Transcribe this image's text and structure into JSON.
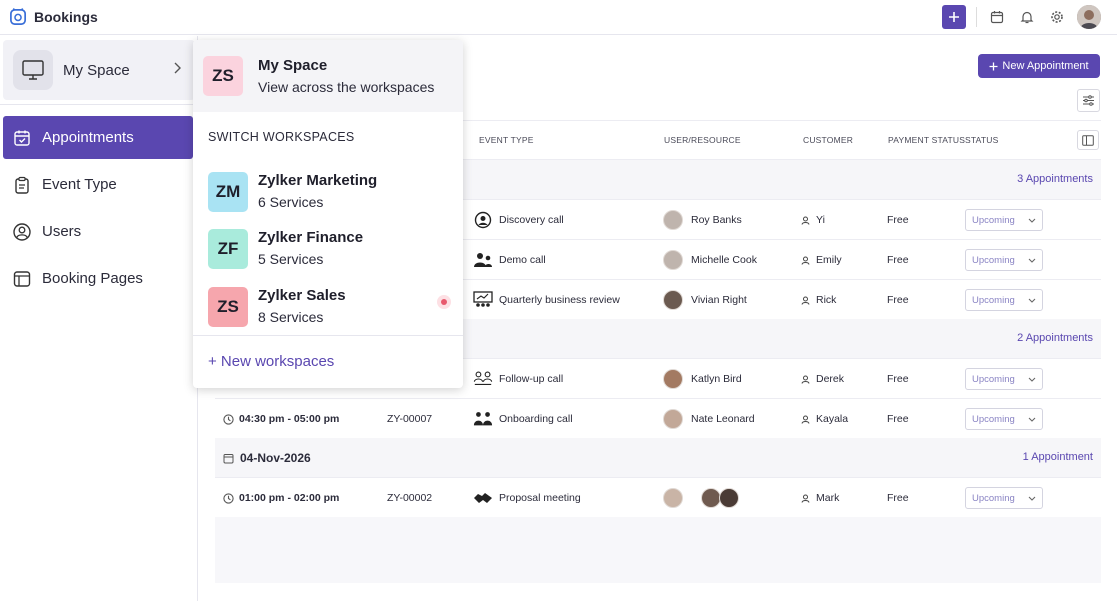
{
  "app": {
    "title": "Bookings"
  },
  "sidebar": {
    "space": {
      "label": "My Space"
    },
    "items": [
      {
        "label": "Appointments",
        "icon": "calendar-check-icon",
        "active": true
      },
      {
        "label": "Event Type",
        "icon": "clipboard-icon",
        "active": false
      },
      {
        "label": "Users",
        "icon": "user-circle-icon",
        "active": false
      },
      {
        "label": "Booking Pages",
        "icon": "browser-window-icon",
        "active": false
      }
    ]
  },
  "toolbar": {
    "new_appointment": "New Appointment"
  },
  "table": {
    "headers": [
      "EVENT TYPE",
      "USER/RESOURCE",
      "CUSTOMER",
      "PAYMENT STATUS",
      "STATUS"
    ],
    "groups": [
      {
        "date": "",
        "count": "3 Appointments",
        "rows": [
          {
            "time": "",
            "id": "",
            "event": "Discovery call",
            "user": "Roy Banks",
            "customer": "Yi",
            "payment": "Free",
            "status": "Upcoming"
          },
          {
            "time": "",
            "id": "",
            "event": "Demo call",
            "user": "Michelle Cook",
            "customer": "Emily",
            "payment": "Free",
            "status": "Upcoming"
          },
          {
            "time": "",
            "id": "",
            "event": "Quarterly business review",
            "user": "Vivian Right",
            "customer": "Rick",
            "payment": "Free",
            "status": "Upcoming"
          }
        ]
      },
      {
        "date": "",
        "count": "2 Appointments",
        "rows": [
          {
            "time": "",
            "id": "",
            "event": "Follow-up call",
            "user": "Katlyn Bird",
            "customer": "Derek",
            "payment": "Free",
            "status": "Upcoming"
          },
          {
            "time": "04:30 pm - 05:00 pm",
            "id": "ZY-00007",
            "event": "Onboarding call",
            "user": "Nate Leonard",
            "customer": "Kayala",
            "payment": "Free",
            "status": "Upcoming"
          }
        ]
      },
      {
        "date": "04-Nov-2026",
        "count": "1 Appointment",
        "rows": [
          {
            "time": "01:00 pm - 02:00 pm",
            "id": "ZY-00002",
            "event": "Proposal meeting",
            "user": "",
            "customer": "Mark",
            "payment": "Free",
            "status": "Upcoming"
          }
        ]
      }
    ]
  },
  "workspace_menu": {
    "current": {
      "initials": "ZS",
      "name": "My Space",
      "subtitle": "View across the workspaces",
      "color": "#fbd3de"
    },
    "section_title": "SWITCH WORKSPACES",
    "workspaces": [
      {
        "initials": "ZM",
        "name": "Zylker Marketing",
        "subtitle": "6 Services",
        "color": "#a9e3f3"
      },
      {
        "initials": "ZF",
        "name": "Zylker Finance",
        "subtitle": "5 Services",
        "color": "#a9ebdc"
      },
      {
        "initials": "ZS",
        "name": "Zylker Sales",
        "subtitle": "8 Services",
        "color": "#f6a6ad"
      }
    ],
    "new_workspace": "+ New workspaces"
  },
  "colors": {
    "accent": "#5a47b0",
    "status_text": "#8a84c4"
  }
}
